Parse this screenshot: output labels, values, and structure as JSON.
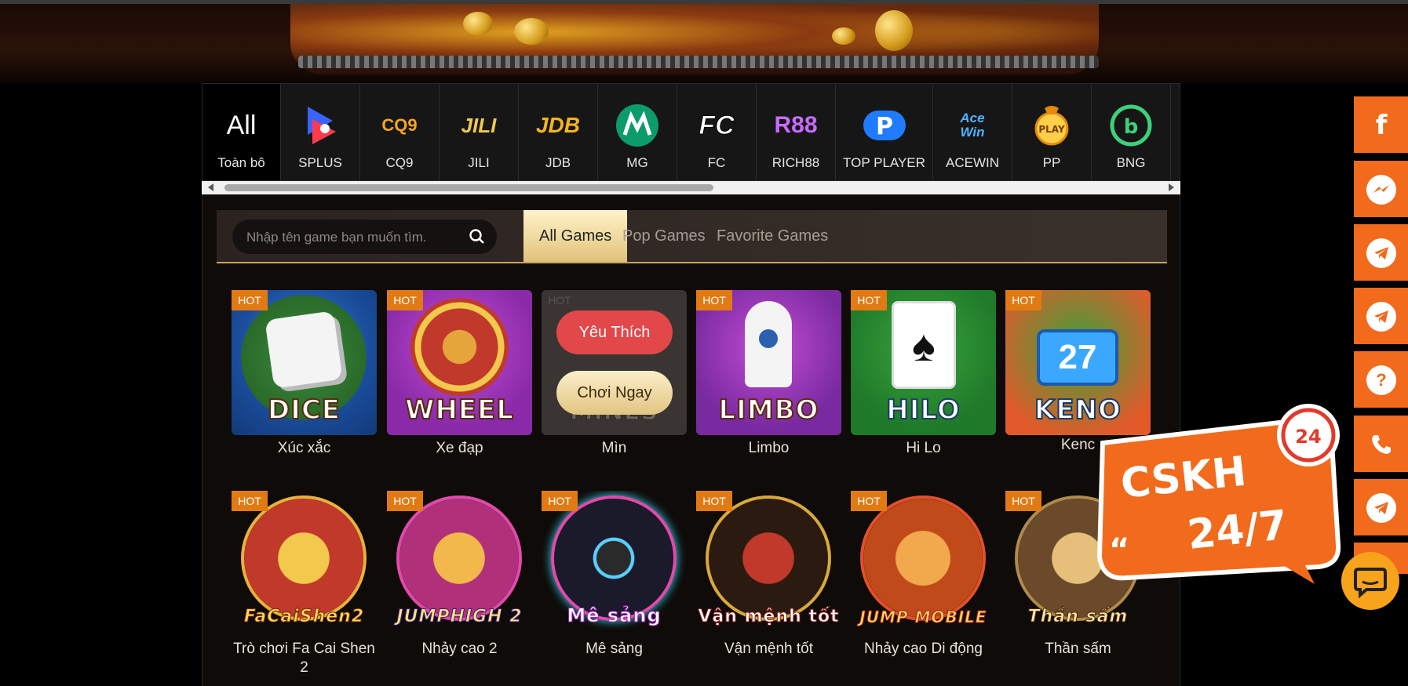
{
  "providers": {
    "all": {
      "big": "All",
      "label": "Toàn bô"
    },
    "items": [
      {
        "label": "SPLUS",
        "logo": "SPLUS"
      },
      {
        "label": "CQ9",
        "logo": "CQ9"
      },
      {
        "label": "JILI",
        "logo": "JILI"
      },
      {
        "label": "JDB",
        "logo": "JDB"
      },
      {
        "label": "MG",
        "logo": "MG"
      },
      {
        "label": "FC",
        "logo": "FC"
      },
      {
        "label": "RICH88",
        "logo": "R88"
      },
      {
        "label": "TOP PLAYER",
        "logo": "P"
      },
      {
        "label": "ACEWIN",
        "logo": "Ace Win"
      },
      {
        "label": "PP",
        "logo": "PLAY"
      },
      {
        "label": "BNG",
        "logo": "b"
      }
    ]
  },
  "search": {
    "placeholder": "Nhập tên game bạn muốn tìm."
  },
  "tabs": [
    "All Games",
    "Pop Games",
    "Favorite Games"
  ],
  "hot_label": "HOT",
  "overlay": {
    "favorite": "Yêu Thích",
    "play": "Chơi Ngay"
  },
  "games_row1": [
    {
      "name": "Xúc xắc",
      "art": "DICE"
    },
    {
      "name": "Xe đạp",
      "art": "WHEEL"
    },
    {
      "name": "Mìn",
      "art": "MINES"
    },
    {
      "name": "Limbo",
      "art": "LIMBO"
    },
    {
      "name": "Hi Lo",
      "art": "HILO"
    },
    {
      "name": "Keno",
      "art": "KENO"
    }
  ],
  "games_row2": [
    {
      "name_l1": "Trò chơi Fa Cai Shen",
      "name_l2": "2",
      "art": "FaCaiShen2"
    },
    {
      "name_l1": "Nhảy cao 2",
      "art": "JUMPHIGH 2"
    },
    {
      "name_l1": "Mê sảng",
      "art": "Mê sảng"
    },
    {
      "name_l1": "Vận mệnh tốt",
      "art": "Vận mệnh tốt"
    },
    {
      "name_l1": "Nhảy cao Di động",
      "art": "JUMP MOBILE"
    },
    {
      "name_l1": "Thần sấm",
      "art": "Thần sấm"
    }
  ],
  "keno_partial": "Kenc",
  "cskh": {
    "line1": "CSKH",
    "line2": "24/7",
    "badge": "24"
  },
  "colors": {
    "accent": "#f26a1b",
    "gold": "#c7a55d",
    "hot": "#e27a13",
    "fav": "#e2474a"
  },
  "side_icons": [
    "facebook-icon",
    "messenger-icon",
    "telegram-icon",
    "telegram-icon",
    "help-icon",
    "phone-icon",
    "telegram-icon"
  ]
}
